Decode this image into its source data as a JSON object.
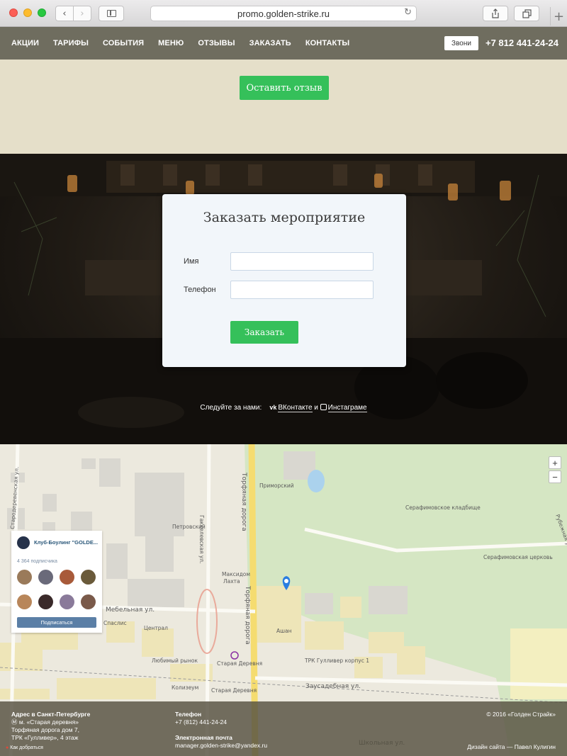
{
  "browser": {
    "url": "promo.golden-strike.ru",
    "back_icon": "chevron-left-icon",
    "forward_icon": "chevron-right-icon"
  },
  "nav": {
    "items": [
      "АКЦИИ",
      "ТАРИФЫ",
      "СОБЫТИЯ",
      "МЕНЮ",
      "ОТЗЫВЫ",
      "ЗАКАЗАТЬ",
      "КОНТАКТЫ"
    ],
    "call_label": "Звони",
    "phone": "+7 812 441-24-24",
    "background": "#6f6d5f"
  },
  "review": {
    "button_label": "Оставить отзыв",
    "accent": "#35c05a"
  },
  "order": {
    "title": "Заказать мероприятие",
    "name_label": "Имя",
    "name_value": "",
    "phone_label": "Телефон",
    "phone_value": "",
    "submit_label": "Заказать"
  },
  "follow": {
    "prefix": "Следуйте за нами:",
    "vk_label": "ВКонтакте",
    "and": "и",
    "ig_label": "Инстаграме"
  },
  "map": {
    "zoom_in": "+",
    "zoom_out": "−",
    "labels": [
      "Стародеревенская ул.",
      "Школьная ул.",
      "Гаккелевская ул.",
      "Торфяная дорога",
      "Мебельная ул.",
      "Заусадебная ул.",
      "Рубежная ул.",
      "Приморский",
      "Серафимовское кладбище",
      "Серафимовская церковь",
      "Петровский",
      "Максидом",
      "Лахта",
      "Спаслис",
      "Централ",
      "Ашан",
      "ТРК Гулливер корпус 1",
      "Старая Деревня",
      "Любимый рынок",
      "Колизеум",
      "Торфяная дорога 7"
    ]
  },
  "vk_widget": {
    "group_name": "Клуб-Боулинг \"GOLDE...",
    "subscribers": "4 364 подписчика",
    "subscribe_label": "Подписаться",
    "avatar_colors": [
      "#9a7a5a",
      "#6a6a7a",
      "#a85a3a",
      "#6a5a3a",
      "#b8865a",
      "#3a2a2a",
      "#8a7a9a",
      "#7a5a4a"
    ]
  },
  "footer": {
    "address_title": "Адрес в Санкт-Петербурге",
    "address_line1": "м. «Старая деревня»",
    "address_line2": "Торфяная дорога дом 7,",
    "address_line3": "ТРК «Гулливер», 4 этаж",
    "directions": "Как добраться",
    "phone_title": "Телефон",
    "phone": "+7 (812) 441-24-24",
    "email_title": "Электронная почта",
    "email": "manager.golden-strike@yandex.ru",
    "copyright": "© 2016 «Голден Страйк»",
    "design": "Дизайн сайта — Павел Кулигин"
  }
}
